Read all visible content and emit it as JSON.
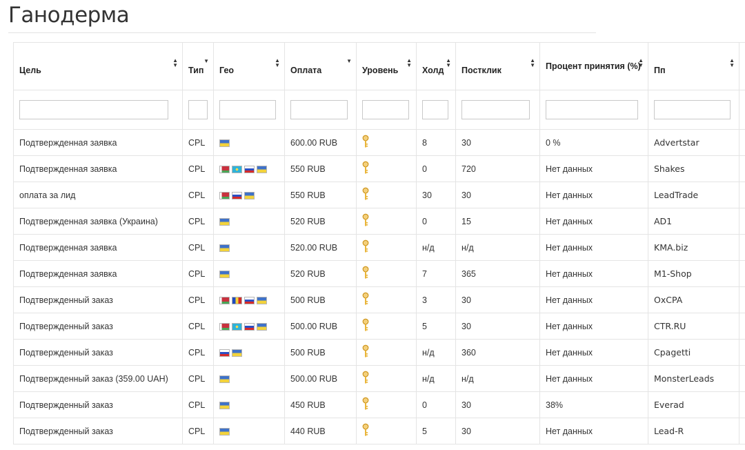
{
  "page": {
    "title": "Ганодерма"
  },
  "table": {
    "columns": [
      {
        "label": "Цель",
        "sort": "both"
      },
      {
        "label": "Тип",
        "sort": "down"
      },
      {
        "label": "Гео",
        "sort": "both"
      },
      {
        "label": "Оплата",
        "sort": "down"
      },
      {
        "label": "Уровень",
        "sort": "both"
      },
      {
        "label": "Холд",
        "sort": "both"
      },
      {
        "label": "Постклик",
        "sort": "both"
      },
      {
        "label": "Процент принятия (%)",
        "sort": "both"
      },
      {
        "label": "Пп",
        "sort": "both"
      }
    ],
    "filters": [
      "",
      "",
      "",
      "",
      "",
      "",
      "",
      "",
      ""
    ],
    "rows": [
      {
        "goal": "Подтвержденная заявка",
        "type": "CPL",
        "geo": [
          "ua"
        ],
        "payout": "600.00 RUB",
        "level": "key-icon",
        "hold": "8",
        "postclick": "30",
        "acceptance": "0 %",
        "network": "Advertstar"
      },
      {
        "goal": "Подтвержденная заявка",
        "type": "CPL",
        "geo": [
          "by",
          "kz",
          "ru",
          "ua"
        ],
        "payout": "550 RUB",
        "level": "key-icon",
        "hold": "0",
        "postclick": "720",
        "acceptance": "Нет данных",
        "network": "Shakes"
      },
      {
        "goal": "оплата за лид",
        "type": "CPL",
        "geo": [
          "by",
          "ru",
          "ua"
        ],
        "payout": "550 RUB",
        "level": "key-icon",
        "hold": "30",
        "postclick": "30",
        "acceptance": "Нет данных",
        "network": "LeadTrade"
      },
      {
        "goal": "Подтвержденная заявка (Украина)",
        "type": "CPL",
        "geo": [
          "ua"
        ],
        "payout": "520 RUB",
        "level": "key-icon",
        "hold": "0",
        "postclick": "15",
        "acceptance": "Нет данных",
        "network": "AD1"
      },
      {
        "goal": "Подтвержденная заявка",
        "type": "CPL",
        "geo": [
          "ua"
        ],
        "payout": "520.00 RUB",
        "level": "key-icon",
        "hold": "н/д",
        "postclick": "н/д",
        "acceptance": "Нет данных",
        "network": "KMA.biz"
      },
      {
        "goal": "Подтвержденная заявка",
        "type": "CPL",
        "geo": [
          "ua"
        ],
        "payout": "520 RUB",
        "level": "key-icon",
        "hold": "7",
        "postclick": "365",
        "acceptance": "Нет данных",
        "network": "M1-Shop"
      },
      {
        "goal": "Подтвержденный заказ",
        "type": "CPL",
        "geo": [
          "by",
          "md",
          "ru",
          "ua"
        ],
        "payout": "500 RUB",
        "level": "key-icon",
        "hold": "3",
        "postclick": "30",
        "acceptance": "Нет данных",
        "network": "OxCPA"
      },
      {
        "goal": "Подтвержденный заказ",
        "type": "CPL",
        "geo": [
          "by",
          "kz",
          "ru",
          "ua"
        ],
        "payout": "500.00 RUB",
        "level": "key-icon",
        "hold": "5",
        "postclick": "30",
        "acceptance": "Нет данных",
        "network": "CTR.RU"
      },
      {
        "goal": "Подтвержденный заказ",
        "type": "CPL",
        "geo": [
          "ru",
          "ua"
        ],
        "payout": "500 RUB",
        "level": "key-icon",
        "hold": "н/д",
        "postclick": "360",
        "acceptance": "Нет данных",
        "network": "Cpagetti"
      },
      {
        "goal": "Подтвержденный заказ (359.00 UAH)",
        "type": "CPL",
        "geo": [
          "ua"
        ],
        "payout": "500.00 RUB",
        "level": "key-icon",
        "hold": "н/д",
        "postclick": "н/д",
        "acceptance": "Нет данных",
        "network": "MonsterLeads"
      },
      {
        "goal": "Подтвержденный заказ",
        "type": "CPL",
        "geo": [
          "ua"
        ],
        "payout": "450 RUB",
        "level": "key-icon",
        "hold": "0",
        "postclick": "30",
        "acceptance": "38%",
        "network": "Everad"
      },
      {
        "goal": "Подтвержденный заказ",
        "type": "CPL",
        "geo": [
          "ua"
        ],
        "payout": "440 RUB",
        "level": "key-icon",
        "hold": "5",
        "postclick": "30",
        "acceptance": "Нет данных",
        "network": "Lead-R"
      }
    ]
  },
  "colors": {
    "key_icon": "#e9b53a",
    "network_text": "#6b5a4e",
    "border": "#e4e4e4"
  }
}
